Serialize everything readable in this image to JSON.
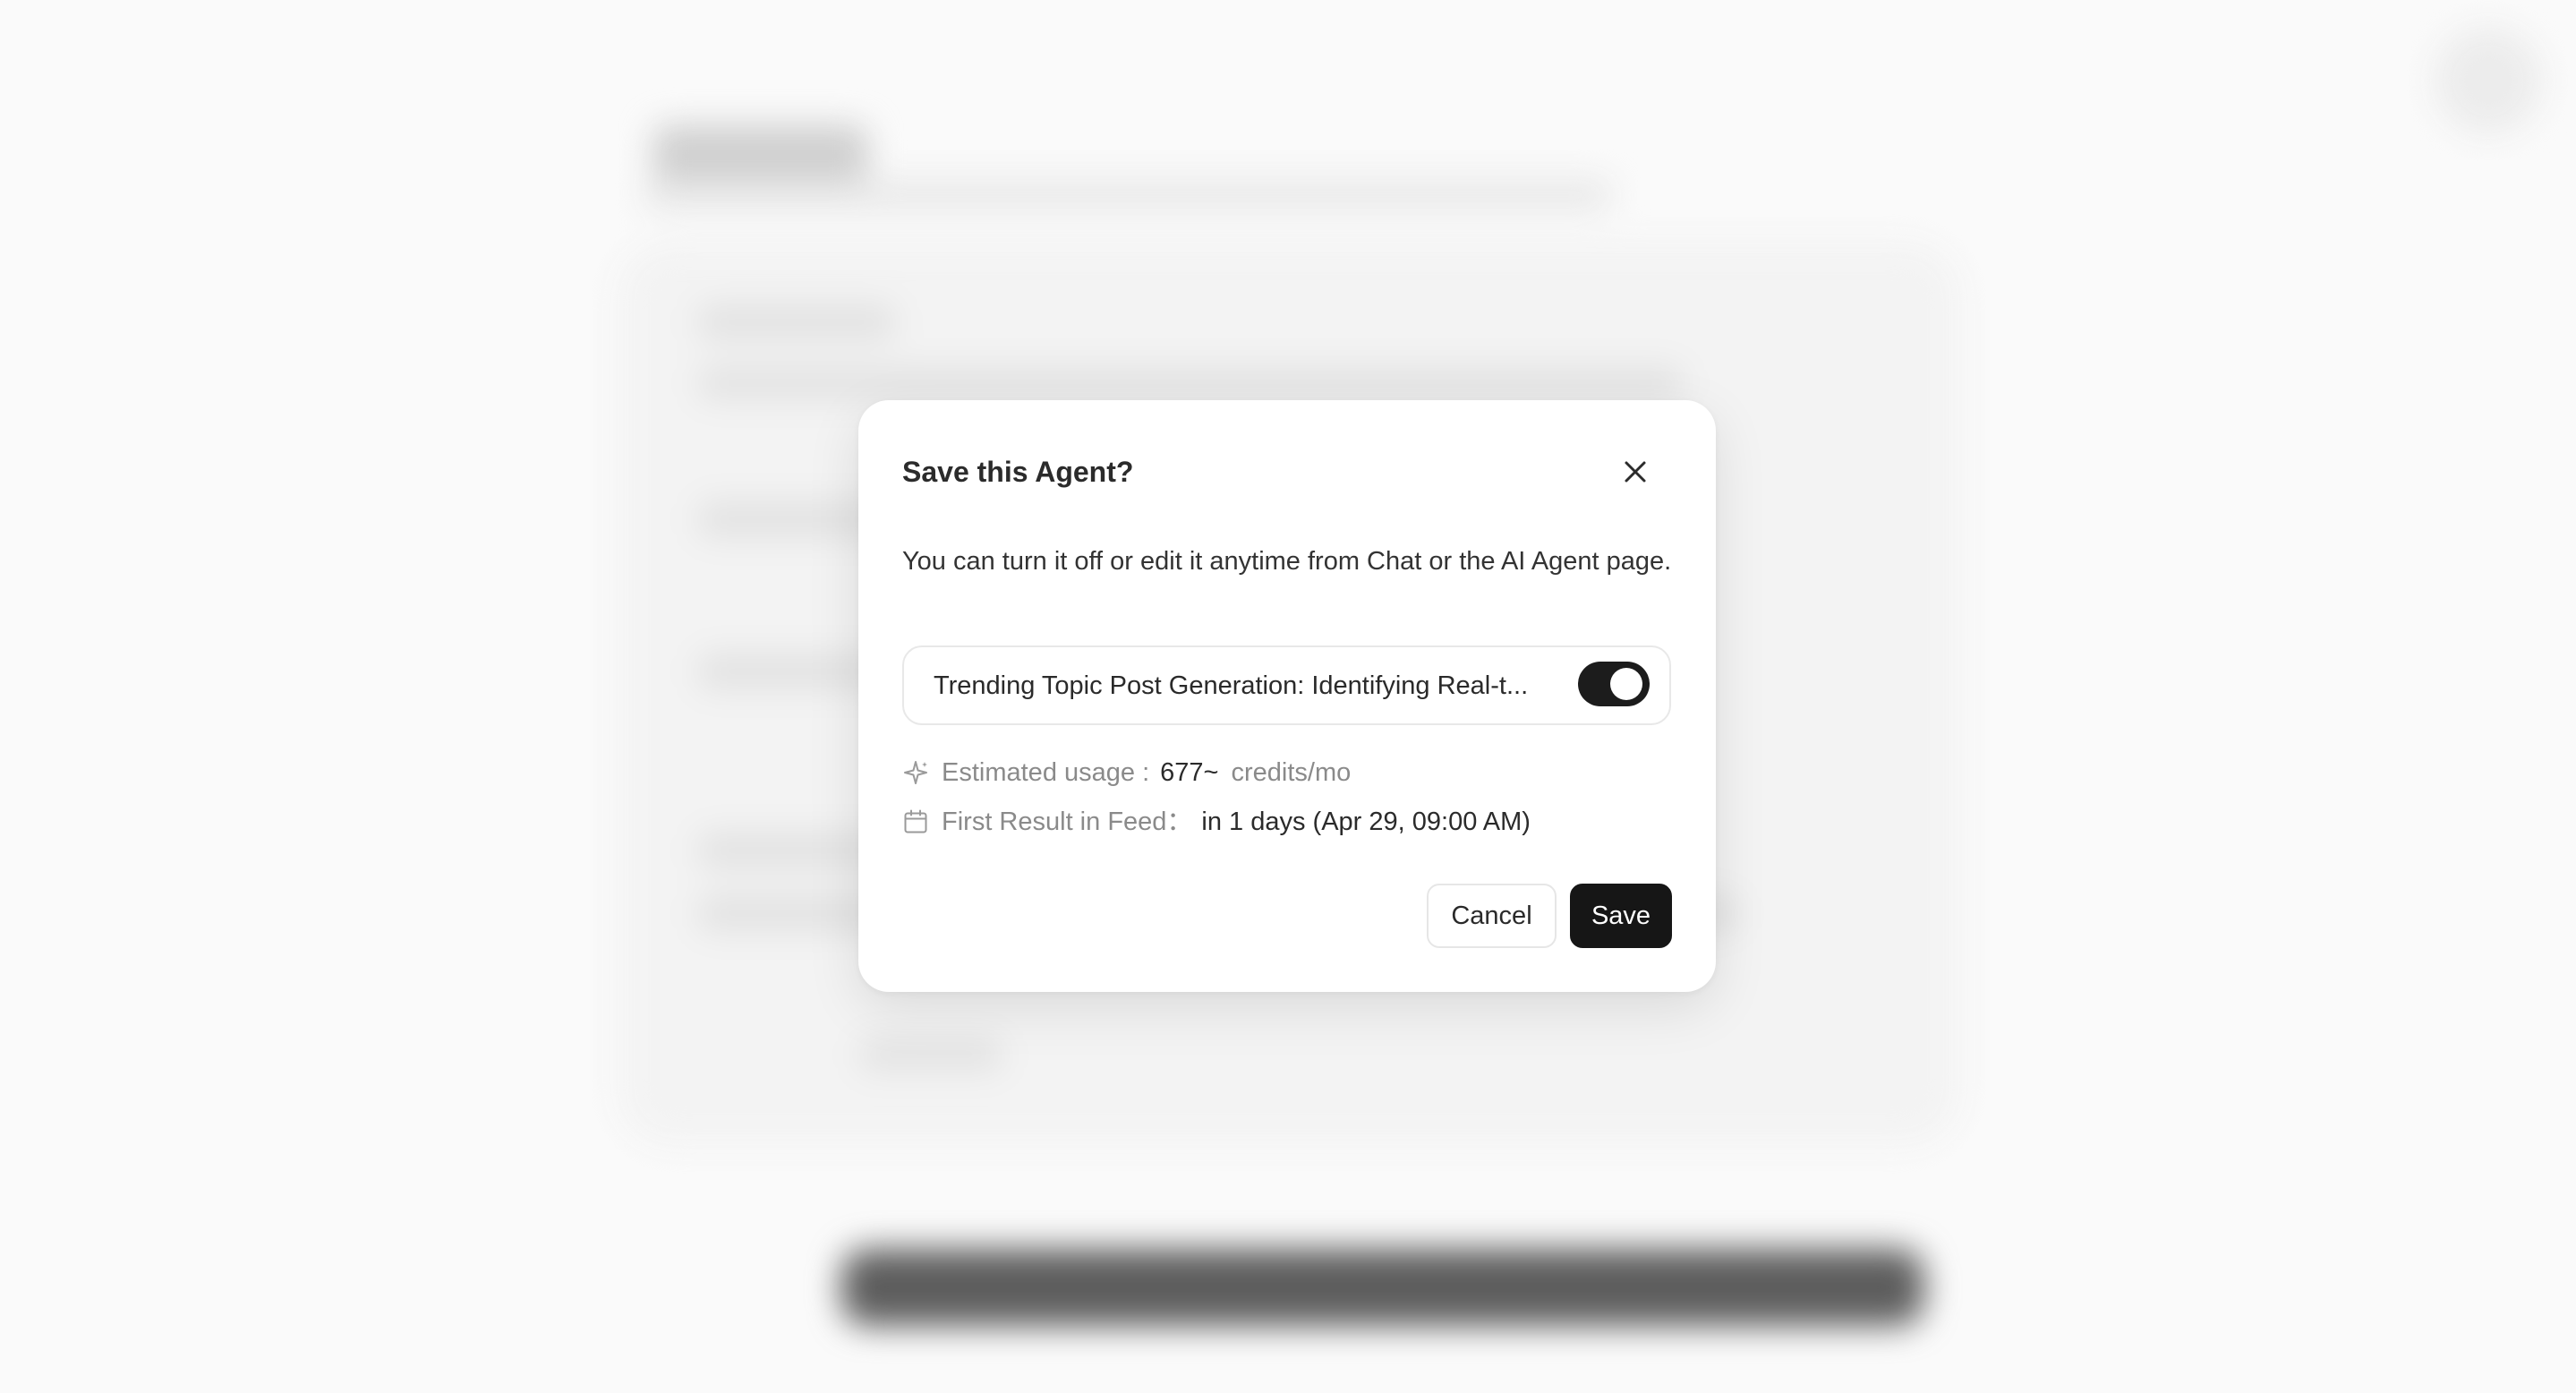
{
  "modal": {
    "title": "Save this Agent?",
    "description": "You can turn it off or edit it anytime from Chat or the AI Agent page.",
    "agent_name": "Trending Topic Post Generation: Identifying Real-t...",
    "toggle_on": true,
    "usage": {
      "label": "Estimated usage :",
      "value": "677~",
      "unit": "credits/mo",
      "icon": "sparkle-icon"
    },
    "feed": {
      "label": "First Result in Feed：",
      "value": "in 1 days (Apr 29, 09:00 AM)",
      "icon": "calendar-icon"
    },
    "cancel_label": "Cancel",
    "save_label": "Save",
    "close_icon": "close-icon"
  },
  "colors": {
    "primary": "#161616",
    "toggle_on": "#1c1c1c",
    "muted_text": "#8a8a8a",
    "border": "#e8e8e8"
  }
}
